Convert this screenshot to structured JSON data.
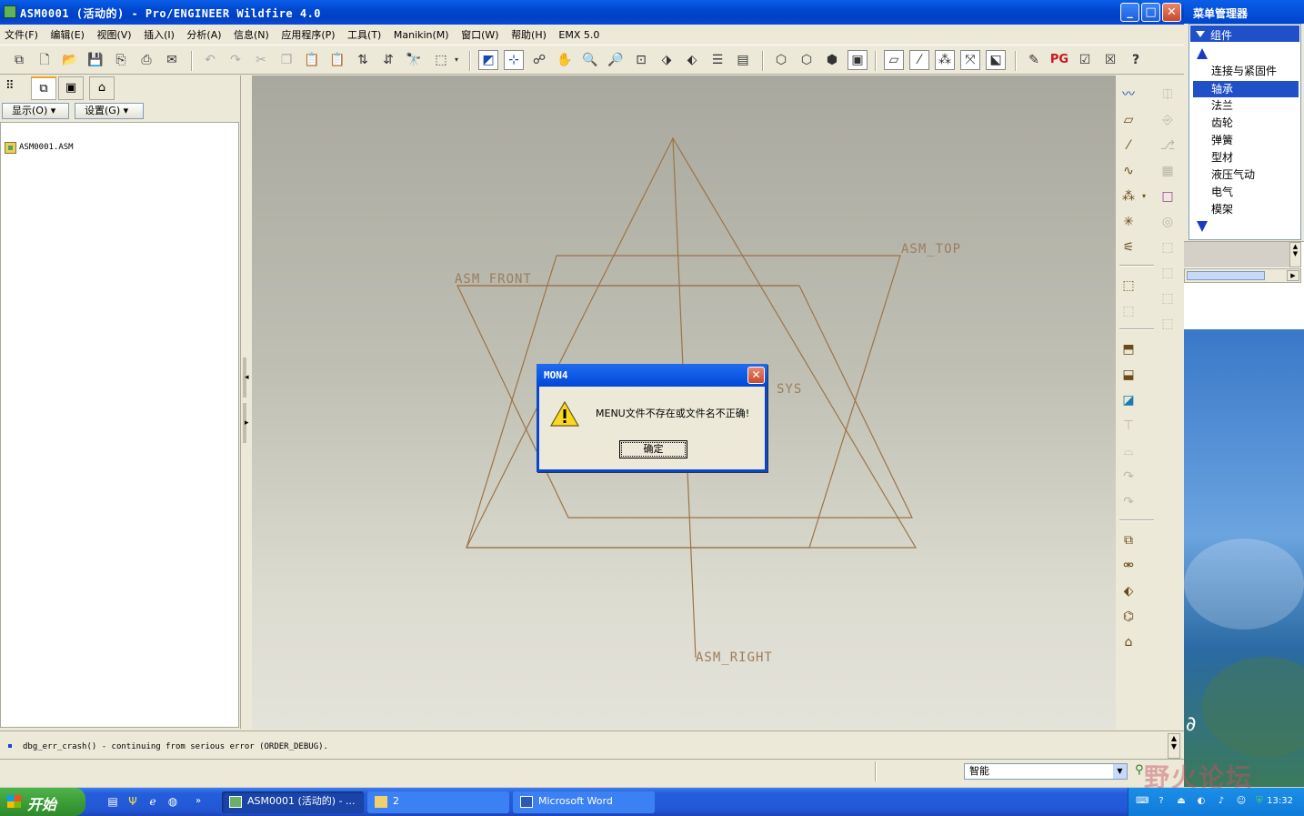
{
  "window": {
    "title": "ASM0001 (活动的) - Pro/ENGINEER Wildfire 4.0",
    "minimize": "_",
    "maximize": "□",
    "close": "✕"
  },
  "menubar": [
    "文件(F)",
    "编辑(E)",
    "视图(V)",
    "插入(I)",
    "分析(A)",
    "信息(N)",
    "应用程序(P)",
    "工具(T)",
    "Manikin(M)",
    "窗口(W)",
    "帮助(H)",
    "EMX 5.0"
  ],
  "toolbar": {
    "pg_label": "PG",
    "help_label": "?"
  },
  "navigator": {
    "show_button": "显示(O)",
    "settings_button": "设置(G)",
    "tree_root": "ASM0001.ASM"
  },
  "viewport": {
    "datum_labels": {
      "top": "ASM_TOP",
      "front": "ASM_FRONT",
      "right": "ASM_RIGHT",
      "csys": "SYS"
    },
    "datum_color": "#9c7d5c"
  },
  "dialog": {
    "title": "MON4",
    "message": "MENU文件不存在或文件名不正确!",
    "ok_button": "确定",
    "close": "✕"
  },
  "message_area": {
    "text": "dbg_err_crash() - continuing from serious error (ORDER_DEBUG)."
  },
  "status": {
    "filter_value": "智能"
  },
  "menu_manager": {
    "title": "菜单管理器",
    "header": "组件",
    "items": [
      "连接与紧固件",
      "轴承",
      "法兰",
      "齿轮",
      "弹簧",
      "型材",
      "液压气动",
      "电气",
      "模架"
    ],
    "selected_index": 1
  },
  "watermark": "野火论坛",
  "taskbar": {
    "start_label": "开始",
    "tasks": [
      "ASM0001 (活动的) - ...",
      "2",
      "Microsoft Word"
    ],
    "clock": "13:32"
  },
  "colors": {
    "xp_blue": "#0047d0",
    "selection": "#2050c8",
    "start_green": "#3a9a36"
  }
}
